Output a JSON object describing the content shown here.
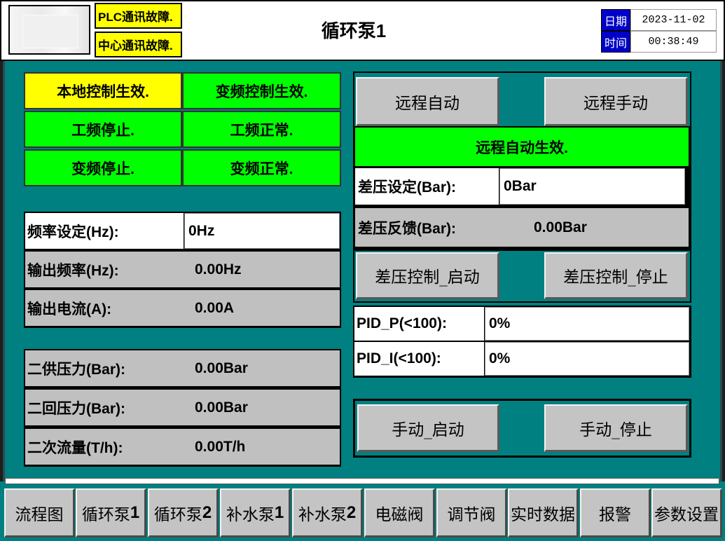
{
  "header": {
    "title": "循环泵1",
    "plc_fault": "PLC通讯故障.",
    "center_fault": "中心通讯故障.",
    "date_label": "日期",
    "date_value": "2023-11-02",
    "time_label": "时间",
    "time_value": "00:38:49"
  },
  "status": {
    "local_control": "本地控制生效.",
    "vfd_control": "变频控制生效.",
    "power_freq_stop": "工频停止.",
    "power_freq_normal": "工频正常.",
    "vfd_stop": "变频停止.",
    "vfd_normal": "变频正常."
  },
  "freq_panel": {
    "freq_set_label": "频率设定(Hz):",
    "freq_set_value": "0Hz",
    "output_freq_label": "输出频率(Hz):",
    "output_freq_value": "0.00Hz",
    "output_current_label": "输出电流(A):",
    "output_current_value": "0.00A"
  },
  "pressure_panel": {
    "supply_label": "二供压力(Bar):",
    "supply_value": "0.00Bar",
    "return_label": "二回压力(Bar):",
    "return_value": "0.00Bar",
    "flow_label": "二次流量(T/h):",
    "flow_value": "0.00T/h"
  },
  "remote": {
    "auto_button": "远程自动",
    "manual_button": "远程手动",
    "auto_active": "远程自动生效.",
    "dp_set_label": "差压设定(Bar):",
    "dp_set_value": "0Bar",
    "dp_feedback_label": "差压反馈(Bar):",
    "dp_feedback_value": "0.00Bar",
    "dp_start_button": "差压控制_启动",
    "dp_stop_button": "差压控制_停止"
  },
  "pid": {
    "p_label": "PID_P(<100):",
    "p_value": "0%",
    "i_label": "PID_I(<100):",
    "i_value": "0%"
  },
  "manual": {
    "start_button": "手动_启动",
    "stop_button": "手动_停止"
  },
  "nav": [
    {
      "text": "流程图",
      "num": ""
    },
    {
      "text": "循环泵",
      "num": "1"
    },
    {
      "text": "循环泵",
      "num": "2"
    },
    {
      "text": "补水泵",
      "num": "1"
    },
    {
      "text": "补水泵",
      "num": "2"
    },
    {
      "text": "电磁阀",
      "num": ""
    },
    {
      "text": "调节阀",
      "num": ""
    },
    {
      "text": "实时数据",
      "num": ""
    },
    {
      "text": "报警",
      "num": ""
    },
    {
      "text": "参数设置",
      "num": ""
    }
  ],
  "colors": {
    "background": "#008080",
    "active_green": "#00ff00",
    "warning_yellow": "#ffff00",
    "date_label_blue": "#0000c8"
  }
}
